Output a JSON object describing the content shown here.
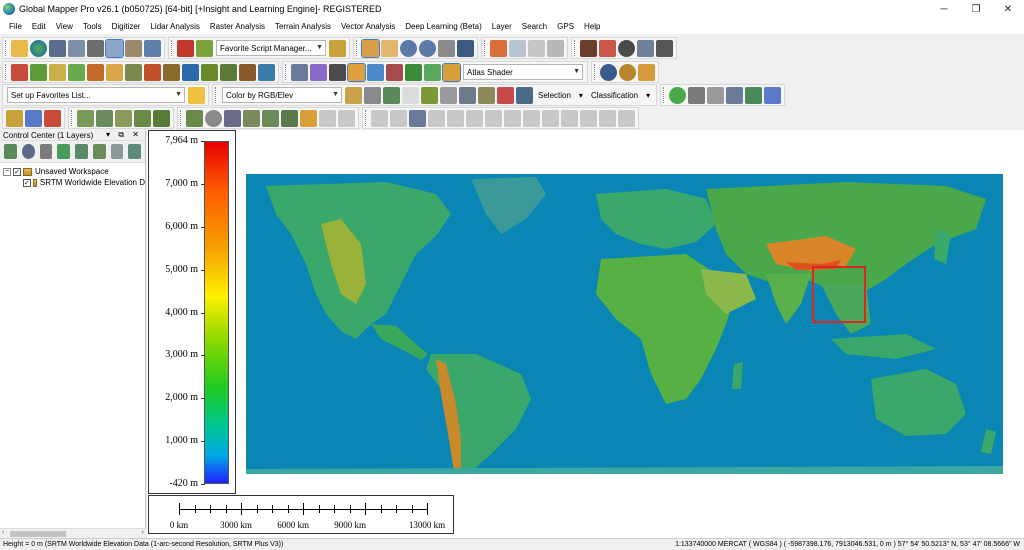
{
  "window": {
    "title": "Global Mapper Pro v26.1 (b050725) [64-bit] [+Insight and Learning Engine]- REGISTERED",
    "minimize": "─",
    "maximize": "❐",
    "close": "✕"
  },
  "menu": [
    "File",
    "Edit",
    "View",
    "Tools",
    "Digitizer",
    "Lidar Analysis",
    "Raster Analysis",
    "Terrain Analysis",
    "Vector Analysis",
    "Deep Learning (Beta)",
    "Layer",
    "Search",
    "GPS",
    "Help"
  ],
  "toolbar": {
    "favorite_script": "Favorite Script Manager...",
    "shader": "Atlas Shader",
    "favorites_list": "Set up Favorites List...",
    "color_mode": "Color by RGB/Elev",
    "selection": "Selection",
    "classification": "Classification"
  },
  "control_center": {
    "title": "Control Center (1 Layers)",
    "header_buttons": "▾ ⧉ ✕",
    "workspace": "Unsaved Workspace",
    "layer": "SRTM Worldwide Elevation D",
    "checked_mark": "✓",
    "expander_mark": "−"
  },
  "legend": {
    "labels": [
      "7,964 m",
      "7,000 m",
      "6,000 m",
      "5,000 m",
      "4,000 m",
      "3,000 m",
      "2,000 m",
      "1,000 m",
      "-420 m"
    ],
    "max_value": 7964,
    "min_value": -420
  },
  "scale_bar": {
    "labels": [
      "0 km",
      "3000 km",
      "6000 km",
      "9000 km",
      "13000 km"
    ]
  },
  "status": {
    "left": "Height = 0 m (SRTM Worldwide Elevation Data (1-arc-second Resolution, SRTM Plus V3))",
    "right": "1:133740000  MERCAT ( WGS84 ) ( -5987398.176, 7913046.531, 0 m )  57° 54' 50.5213\" N, 53° 47' 08.5666\" W"
  },
  "colors": {
    "ocean": "#0a86b4",
    "selection_box": "#e0241f",
    "accent": "#3a7bd5"
  }
}
